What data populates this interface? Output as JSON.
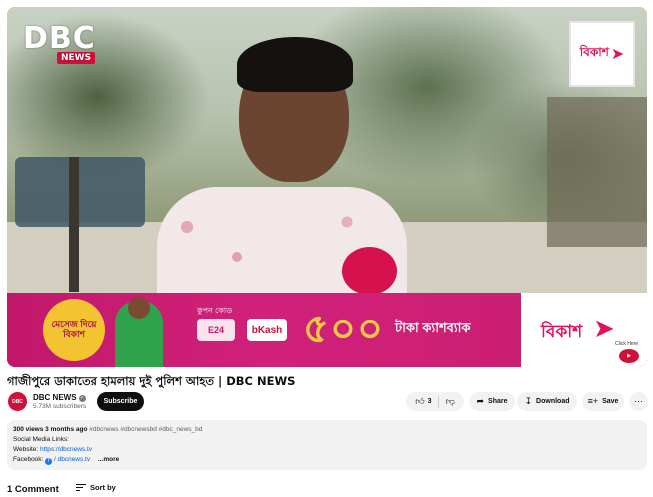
{
  "player": {
    "logo_text": "DBC",
    "logo_sub": "NEWS",
    "sponsor_brand": "বিকাশ",
    "ad": {
      "circle_text": "মেসেজ দিয়ে বিকাশ",
      "pill_top": "কুপন কোড",
      "pill": "E24",
      "badge_text": "bKash",
      "big_number": "৫০০",
      "offer_text": "টাকা ক্যাশব্যাক",
      "brand": "বিকাশ",
      "click_text": "Click Here"
    }
  },
  "video": {
    "title": "গাজীপুরে ডাকাতের হামলায় দুই পুলিশ আহত | DBC NEWS"
  },
  "channel": {
    "avatar_text": "DBC",
    "name": "DBC NEWS",
    "subscribers": "5.73M subscribers",
    "subscribe_label": "Subscribe"
  },
  "actions": {
    "like_count": "3",
    "share_label": "Share",
    "download_label": "Download",
    "save_label": "Save"
  },
  "description": {
    "views": "300 views",
    "age": "3 months ago",
    "hashtags": "#dbcnews #dbcnewsbd #dbc_news_bd",
    "line1": "Social Media Links:",
    "website_label": "Website:",
    "website_url": "https://dbcnews.tv",
    "facebook_label": "Facebook:",
    "facebook_value": "/ dbcnews.tv",
    "more_label": "...more"
  },
  "comments": {
    "count_label": "1 Comment",
    "sort_label": "Sort by"
  },
  "icons": {
    "like": "thumbs-up-icon",
    "dislike": "thumbs-down-icon",
    "share": "share-arrow-icon",
    "download": "download-icon",
    "save": "playlist-add-icon",
    "more": "more-dots-icon",
    "sort": "sort-icon",
    "verified": "verified-check-icon",
    "facebook": "facebook-icon"
  }
}
